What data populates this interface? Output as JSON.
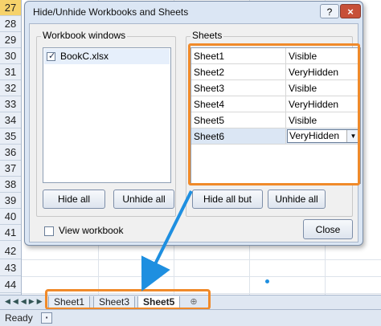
{
  "excel": {
    "rows": [
      "27",
      "28",
      "29",
      "30",
      "31",
      "32",
      "33",
      "34",
      "35",
      "36",
      "37",
      "38",
      "39",
      "40",
      "41",
      "42",
      "43",
      "44"
    ],
    "active_row": "27",
    "sheet_tabs": [
      {
        "label": "Sheet1",
        "active": false
      },
      {
        "label": "Sheet3",
        "active": false
      },
      {
        "label": "Sheet5",
        "active": true
      }
    ],
    "status": "Ready"
  },
  "dialog": {
    "title": "Hide/Unhide Workbooks and Sheets",
    "help_label": "?",
    "close_icon": "×",
    "workbook_windows": {
      "label": "Workbook windows",
      "items": [
        {
          "name": "BookC.xlsx",
          "checked": true
        }
      ]
    },
    "sheets": {
      "label": "Sheets",
      "rows": [
        {
          "name": "Sheet1",
          "status": "Visible"
        },
        {
          "name": "Sheet2",
          "status": "VeryHidden"
        },
        {
          "name": "Sheet3",
          "status": "Visible"
        },
        {
          "name": "Sheet4",
          "status": "VeryHidden"
        },
        {
          "name": "Sheet5",
          "status": "Visible"
        },
        {
          "name": "Sheet6",
          "status": "VeryHidden"
        }
      ],
      "selected_index": 5
    },
    "buttons": {
      "hide_all": "Hide all",
      "unhide_all": "Unhide all",
      "hide_all_but": "Hide all but",
      "unhide_all_sheets": "Unhide all",
      "close": "Close"
    },
    "view_workbook": {
      "label": "View workbook",
      "checked": false
    }
  },
  "colors": {
    "highlight_orange": "#f08a2a",
    "arrow_blue": "#1e8fe0",
    "close_red": "#c75038"
  }
}
